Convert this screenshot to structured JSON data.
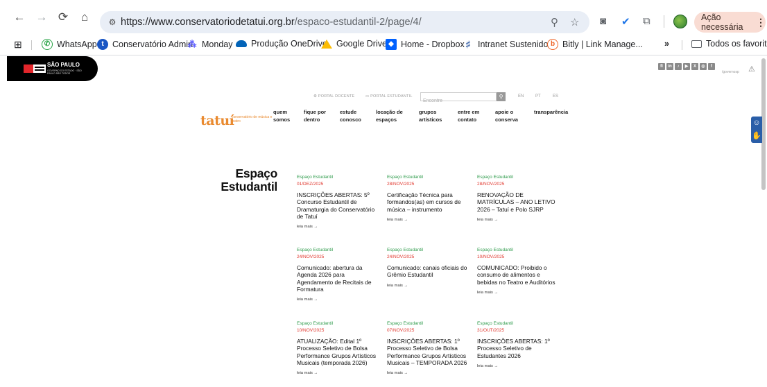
{
  "browser": {
    "url_host": "https://www.conservatoriodetatui.org.br",
    "url_path": "/espaco-estudantil-2/page/4/",
    "action_button": "Ação necessária",
    "bookmarks": [
      {
        "label": "WhatsApp",
        "icon": "whatsapp-icon"
      },
      {
        "label": "Conservatório Admin",
        "icon": "ct-icon"
      },
      {
        "label": "Monday",
        "icon": "monday-icon"
      },
      {
        "label": "Produção OneDrive",
        "icon": "onedrive-icon"
      },
      {
        "label": "Google Drive",
        "icon": "google-drive-icon"
      },
      {
        "label": "Home - Dropbox",
        "icon": "dropbox-icon"
      },
      {
        "label": "Intranet Sustenidos",
        "icon": "sustenidos-icon"
      },
      {
        "label": "Bitly | Link Manage...",
        "icon": "bitly-icon"
      }
    ],
    "more_bookmarks": "»",
    "all_favorites": "Todos os favoritos"
  },
  "site": {
    "gov_logo": {
      "title": "SÃO PAULO",
      "subtitle": "GOVERNO DO ESTADO · SÃO PAULO SÃO TODOS"
    },
    "social_handle": "/governosp",
    "top_links": {
      "portal_docente": "PORTAL DOCENTE",
      "portal_estudantil": "PORTAL ESTUDANTIL"
    },
    "search_placeholder": "Encontre",
    "languages": [
      "EN",
      "PT",
      "ES"
    ],
    "logo": {
      "name": "tatuí",
      "subtitle": "conservatório de música e teatro"
    },
    "nav": [
      "quem\nsomos",
      "fique por\ndentro",
      "estude\nconosco",
      "locação de\nespaços",
      "grupos\nartísticos",
      "entre em\ncontato",
      "apoie o\nconserva",
      "transparência"
    ]
  },
  "section_title": "Espaço Estudantil",
  "read_more": "leia mais →",
  "posts": [
    {
      "category": "Espaço Estudantil",
      "date": "01/DEZ/2025",
      "title": "INSCRIÇÕES ABERTAS: 5º Concurso Estudantil de Dramaturgia do Conservatório de Tatuí"
    },
    {
      "category": "Espaço Estudantil",
      "date": "28/NOV/2025",
      "title": "Certificação Técnica para formandos(as) em cursos de música – instrumento"
    },
    {
      "category": "Espaço Estudantil",
      "date": "28/NOV/2025",
      "title": "RENOVAÇÃO DE MATRÍCULAS – ANO LETIVO 2026 – Tatuí e Polo SJRP"
    },
    {
      "category": "Espaço Estudantil",
      "date": "24/NOV/2025",
      "title": "Comunicado: abertura da Agenda 2026 para Agendamento de Recitais de Formatura"
    },
    {
      "category": "Espaço Estudantil",
      "date": "24/NOV/2025",
      "title": "Comunicado: canais oficiais do Grêmio Estudantil"
    },
    {
      "category": "Espaço Estudantil",
      "date": "10/NOV/2025",
      "title": "COMUNICADO: Proibido o consumo de alimentos e bebidas no Teatro e Auditórios"
    },
    {
      "category": "Espaço Estudantil",
      "date": "10/NOV/2025",
      "title": "ATUALIZAÇÃO: Edital 1º Processo Seletivo de Bolsa Performance Grupos Artísticos Musicais (temporada 2026)"
    },
    {
      "category": "Espaço Estudantil",
      "date": "07/NOV/2025",
      "title": "INSCRIÇÕES ABERTAS: 1º Processo Seletivo de Bolsa Performance Grupos Artísticos Musicais – TEMPORADA 2026"
    },
    {
      "category": "Espaço Estudantil",
      "date": "31/OUT/2025",
      "title": "INSCRIÇÕES ABERTAS: 1º Processo Seletivo de Estudantes 2026"
    }
  ]
}
